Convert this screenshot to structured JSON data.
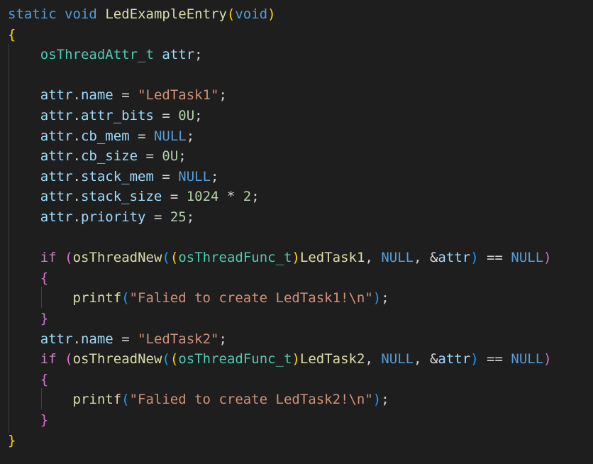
{
  "editor": {
    "theme_colors": {
      "background": "#1e1e1e",
      "keyword": "#569cd6",
      "control": "#c586c0",
      "function": "#dcdcaa",
      "type": "#4ec9b0",
      "variable": "#9cdcfe",
      "string": "#ce9178",
      "number": "#b5cea8",
      "bracket_level1": "#ffd700",
      "bracket_level2": "#da70d6",
      "bracket_level3": "#179fff"
    },
    "lines": [
      {
        "tokens": [
          {
            "t": "kw",
            "v": "static"
          },
          {
            "t": "plain",
            "v": " "
          },
          {
            "t": "kw",
            "v": "void"
          },
          {
            "t": "plain",
            "v": " "
          },
          {
            "t": "fn",
            "v": "LedExampleEntry"
          },
          {
            "t": "b1",
            "v": "("
          },
          {
            "t": "kw",
            "v": "void"
          },
          {
            "t": "b1",
            "v": ")"
          }
        ]
      },
      {
        "tokens": [
          {
            "t": "b1",
            "v": "{"
          }
        ]
      },
      {
        "tokens": [
          {
            "t": "plain",
            "v": "    "
          },
          {
            "t": "ty",
            "v": "osThreadAttr_t"
          },
          {
            "t": "plain",
            "v": " "
          },
          {
            "t": "var",
            "v": "attr"
          },
          {
            "t": "plain",
            "v": ";"
          }
        ]
      },
      {
        "tokens": []
      },
      {
        "tokens": [
          {
            "t": "plain",
            "v": "    "
          },
          {
            "t": "var",
            "v": "attr"
          },
          {
            "t": "plain",
            "v": "."
          },
          {
            "t": "var",
            "v": "name"
          },
          {
            "t": "plain",
            "v": " = "
          },
          {
            "t": "str",
            "v": "\"LedTask1\""
          },
          {
            "t": "plain",
            "v": ";"
          }
        ]
      },
      {
        "tokens": [
          {
            "t": "plain",
            "v": "    "
          },
          {
            "t": "var",
            "v": "attr"
          },
          {
            "t": "plain",
            "v": "."
          },
          {
            "t": "var",
            "v": "attr_bits"
          },
          {
            "t": "plain",
            "v": " = "
          },
          {
            "t": "num",
            "v": "0U"
          },
          {
            "t": "plain",
            "v": ";"
          }
        ]
      },
      {
        "tokens": [
          {
            "t": "plain",
            "v": "    "
          },
          {
            "t": "var",
            "v": "attr"
          },
          {
            "t": "plain",
            "v": "."
          },
          {
            "t": "var",
            "v": "cb_mem"
          },
          {
            "t": "plain",
            "v": " = "
          },
          {
            "t": "kw",
            "v": "NULL"
          },
          {
            "t": "plain",
            "v": ";"
          }
        ]
      },
      {
        "tokens": [
          {
            "t": "plain",
            "v": "    "
          },
          {
            "t": "var",
            "v": "attr"
          },
          {
            "t": "plain",
            "v": "."
          },
          {
            "t": "var",
            "v": "cb_size"
          },
          {
            "t": "plain",
            "v": " = "
          },
          {
            "t": "num",
            "v": "0U"
          },
          {
            "t": "plain",
            "v": ";"
          }
        ]
      },
      {
        "tokens": [
          {
            "t": "plain",
            "v": "    "
          },
          {
            "t": "var",
            "v": "attr"
          },
          {
            "t": "plain",
            "v": "."
          },
          {
            "t": "var",
            "v": "stack_mem"
          },
          {
            "t": "plain",
            "v": " = "
          },
          {
            "t": "kw",
            "v": "NULL"
          },
          {
            "t": "plain",
            "v": ";"
          }
        ]
      },
      {
        "tokens": [
          {
            "t": "plain",
            "v": "    "
          },
          {
            "t": "var",
            "v": "attr"
          },
          {
            "t": "plain",
            "v": "."
          },
          {
            "t": "var",
            "v": "stack_size"
          },
          {
            "t": "plain",
            "v": " = "
          },
          {
            "t": "num",
            "v": "1024"
          },
          {
            "t": "plain",
            "v": " * "
          },
          {
            "t": "num",
            "v": "2"
          },
          {
            "t": "plain",
            "v": ";"
          }
        ]
      },
      {
        "tokens": [
          {
            "t": "plain",
            "v": "    "
          },
          {
            "t": "var",
            "v": "attr"
          },
          {
            "t": "plain",
            "v": "."
          },
          {
            "t": "var",
            "v": "priority"
          },
          {
            "t": "plain",
            "v": " = "
          },
          {
            "t": "num",
            "v": "25"
          },
          {
            "t": "plain",
            "v": ";"
          }
        ]
      },
      {
        "tokens": []
      },
      {
        "tokens": [
          {
            "t": "plain",
            "v": "    "
          },
          {
            "t": "ctl",
            "v": "if"
          },
          {
            "t": "plain",
            "v": " "
          },
          {
            "t": "b2",
            "v": "("
          },
          {
            "t": "fn",
            "v": "osThreadNew"
          },
          {
            "t": "b3",
            "v": "("
          },
          {
            "t": "b1",
            "v": "("
          },
          {
            "t": "ty",
            "v": "osThreadFunc_t"
          },
          {
            "t": "b1",
            "v": ")"
          },
          {
            "t": "fn",
            "v": "LedTask1"
          },
          {
            "t": "plain",
            "v": ", "
          },
          {
            "t": "kw",
            "v": "NULL"
          },
          {
            "t": "plain",
            "v": ", &"
          },
          {
            "t": "var",
            "v": "attr"
          },
          {
            "t": "b3",
            "v": ")"
          },
          {
            "t": "plain",
            "v": " == "
          },
          {
            "t": "kw",
            "v": "NULL"
          },
          {
            "t": "b2",
            "v": ")"
          }
        ]
      },
      {
        "tokens": [
          {
            "t": "plain",
            "v": "    "
          },
          {
            "t": "b2",
            "v": "{"
          }
        ]
      },
      {
        "tokens": [
          {
            "t": "plain",
            "v": "        "
          },
          {
            "t": "fn",
            "v": "printf"
          },
          {
            "t": "b3",
            "v": "("
          },
          {
            "t": "str",
            "v": "\"Falied to create LedTask1!\\n\""
          },
          {
            "t": "b3",
            "v": ")"
          },
          {
            "t": "plain",
            "v": ";"
          }
        ]
      },
      {
        "tokens": [
          {
            "t": "plain",
            "v": "    "
          },
          {
            "t": "b2",
            "v": "}"
          }
        ]
      },
      {
        "tokens": [
          {
            "t": "plain",
            "v": "    "
          },
          {
            "t": "var",
            "v": "attr"
          },
          {
            "t": "plain",
            "v": "."
          },
          {
            "t": "var",
            "v": "name"
          },
          {
            "t": "plain",
            "v": " = "
          },
          {
            "t": "str",
            "v": "\"LedTask2\""
          },
          {
            "t": "plain",
            "v": ";"
          }
        ]
      },
      {
        "tokens": [
          {
            "t": "plain",
            "v": "    "
          },
          {
            "t": "ctl",
            "v": "if"
          },
          {
            "t": "plain",
            "v": " "
          },
          {
            "t": "b2",
            "v": "("
          },
          {
            "t": "fn",
            "v": "osThreadNew"
          },
          {
            "t": "b3",
            "v": "("
          },
          {
            "t": "b1",
            "v": "("
          },
          {
            "t": "ty",
            "v": "osThreadFunc_t"
          },
          {
            "t": "b1",
            "v": ")"
          },
          {
            "t": "fn",
            "v": "LedTask2"
          },
          {
            "t": "plain",
            "v": ", "
          },
          {
            "t": "kw",
            "v": "NULL"
          },
          {
            "t": "plain",
            "v": ", &"
          },
          {
            "t": "var",
            "v": "attr"
          },
          {
            "t": "b3",
            "v": ")"
          },
          {
            "t": "plain",
            "v": " == "
          },
          {
            "t": "kw",
            "v": "NULL"
          },
          {
            "t": "b2",
            "v": ")"
          }
        ]
      },
      {
        "tokens": [
          {
            "t": "plain",
            "v": "    "
          },
          {
            "t": "b2",
            "v": "{"
          }
        ]
      },
      {
        "tokens": [
          {
            "t": "plain",
            "v": "        "
          },
          {
            "t": "fn",
            "v": "printf"
          },
          {
            "t": "b3",
            "v": "("
          },
          {
            "t": "str",
            "v": "\"Falied to create LedTask2!\\n\""
          },
          {
            "t": "b3",
            "v": ")"
          },
          {
            "t": "plain",
            "v": ";"
          }
        ]
      },
      {
        "tokens": [
          {
            "t": "plain",
            "v": "    "
          },
          {
            "t": "b2",
            "v": "}"
          }
        ]
      },
      {
        "tokens": [
          {
            "t": "b1",
            "v": "}"
          }
        ]
      }
    ]
  }
}
